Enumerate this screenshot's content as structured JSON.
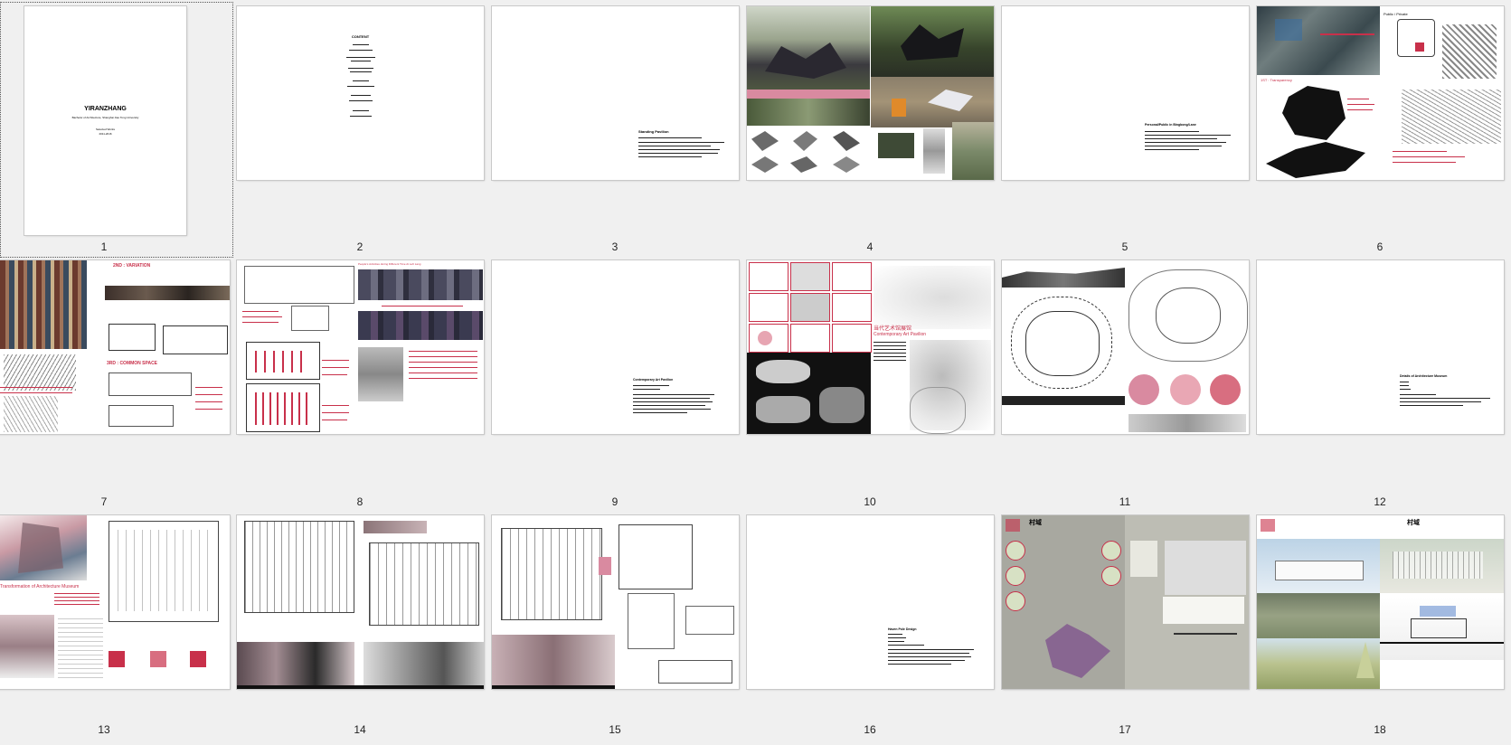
{
  "thumbnails": [
    {
      "number": "1",
      "title": "YIRANZHANG",
      "subtitle": "Bachelor of Architecture, Shanghai Jiao Tong University",
      "lines": [
        "Selected Works",
        "2011-2016"
      ]
    },
    {
      "number": "2",
      "title": "CONTENT"
    },
    {
      "number": "3",
      "title": "Standing Pavilion"
    },
    {
      "number": "4"
    },
    {
      "number": "5",
      "title": "Personal/Public in Bingbong/Lane"
    },
    {
      "number": "6",
      "tags": [
        "Public / Private",
        "1ST : Transparency"
      ]
    },
    {
      "number": "7",
      "tags": [
        "2ND : VARIATION",
        "3RD : COMMON SPACE"
      ]
    },
    {
      "number": "8",
      "tags": [
        "People's Activities during Different Time At Left Lang"
      ]
    },
    {
      "number": "9",
      "title": "Contemporary Art Pavilion"
    },
    {
      "number": "10",
      "tags": [
        "当代艺术馆展馆",
        "Contemporary Art Pavilion"
      ]
    },
    {
      "number": "11"
    },
    {
      "number": "12",
      "title": "Details of Architecture Museum"
    },
    {
      "number": "13",
      "tags": [
        "Transformation of Architecture Museum"
      ]
    },
    {
      "number": "14"
    },
    {
      "number": "15"
    },
    {
      "number": "16",
      "title": "Haven Pole Design"
    },
    {
      "number": "17",
      "tags": [
        "村域"
      ]
    },
    {
      "number": "18",
      "tags": [
        "村域"
      ]
    }
  ],
  "colors": {
    "background": "#f0f0f0",
    "page": "#ffffff",
    "accent": "#c8304a"
  }
}
